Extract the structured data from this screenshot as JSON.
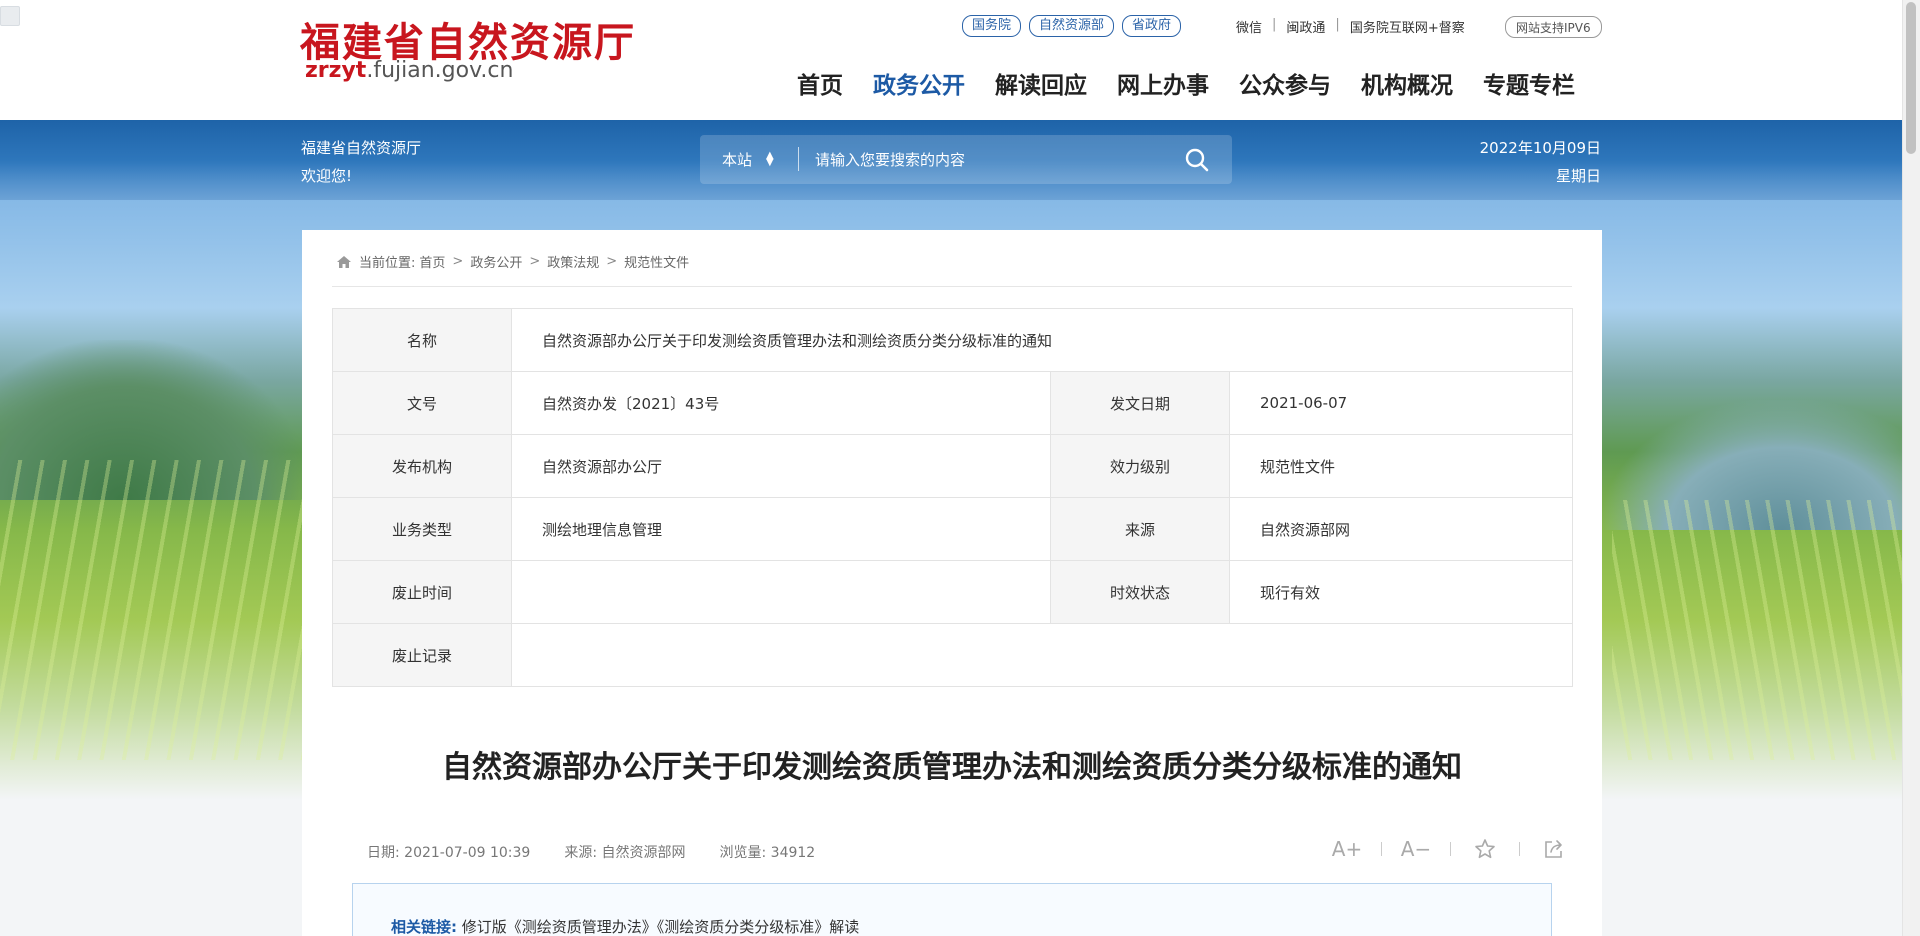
{
  "header": {
    "logo_cn": "福建省自然资源厅",
    "logo_en_bold": "zrzyt",
    "logo_en_rest": ".fujian.gov.cn",
    "pill_links": [
      "国务院",
      "自然资源部",
      "省政府"
    ],
    "text_links": [
      "微信",
      "闽政通",
      "国务院互联网+督察"
    ],
    "ipv6": "网站支持IPV6",
    "nav": [
      "首页",
      "政务公开",
      "解读回应",
      "网上办事",
      "公众参与",
      "机构概况",
      "专题专栏"
    ],
    "nav_active_index": 1
  },
  "banner": {
    "welcome_line1": "福建省自然资源厅",
    "welcome_line2": "欢迎您!",
    "search_scope": "本站",
    "search_placeholder": "请输入您要搜索的内容",
    "date": "2022年10月09日",
    "weekday": "星期日"
  },
  "breadcrumb": {
    "prefix": "当前位置:",
    "items": [
      "首页",
      "政务公开",
      "政策法规",
      "规范性文件"
    ]
  },
  "meta": {
    "name_label": "名称",
    "name_value": "自然资源部办公厅关于印发测绘资质管理办法和测绘资质分类分级标准的通知",
    "docno_label": "文号",
    "docno_value": "自然资办发〔2021〕43号",
    "issue_date_label": "发文日期",
    "issue_date_value": "2021-06-07",
    "org_label": "发布机构",
    "org_value": "自然资源部办公厅",
    "level_label": "效力级别",
    "level_value": "规范性文件",
    "type_label": "业务类型",
    "type_value": "测绘地理信息管理",
    "source_label": "来源",
    "source_value": "自然资源部网",
    "abolish_time_label": "废止时间",
    "abolish_time_value": "",
    "status_label": "时效状态",
    "status_value": "现行有效",
    "abolish_record_label": "废止记录",
    "abolish_record_value": ""
  },
  "article": {
    "title": "自然资源部办公厅关于印发测绘资质管理办法和测绘资质分类分级标准的通知",
    "date": "日期:  2021-07-09 10:39",
    "source": "来源:  自然资源部网",
    "views": "浏览量:  34912",
    "font_larger": "A+",
    "font_smaller": "A−",
    "related_label": "相关链接:",
    "related_text": "修订版《测绘资质管理办法》《测绘资质分类分级标准》解读"
  },
  "colors": {
    "brand_red": "#c8161e",
    "brand_blue": "#1d5aa5"
  }
}
